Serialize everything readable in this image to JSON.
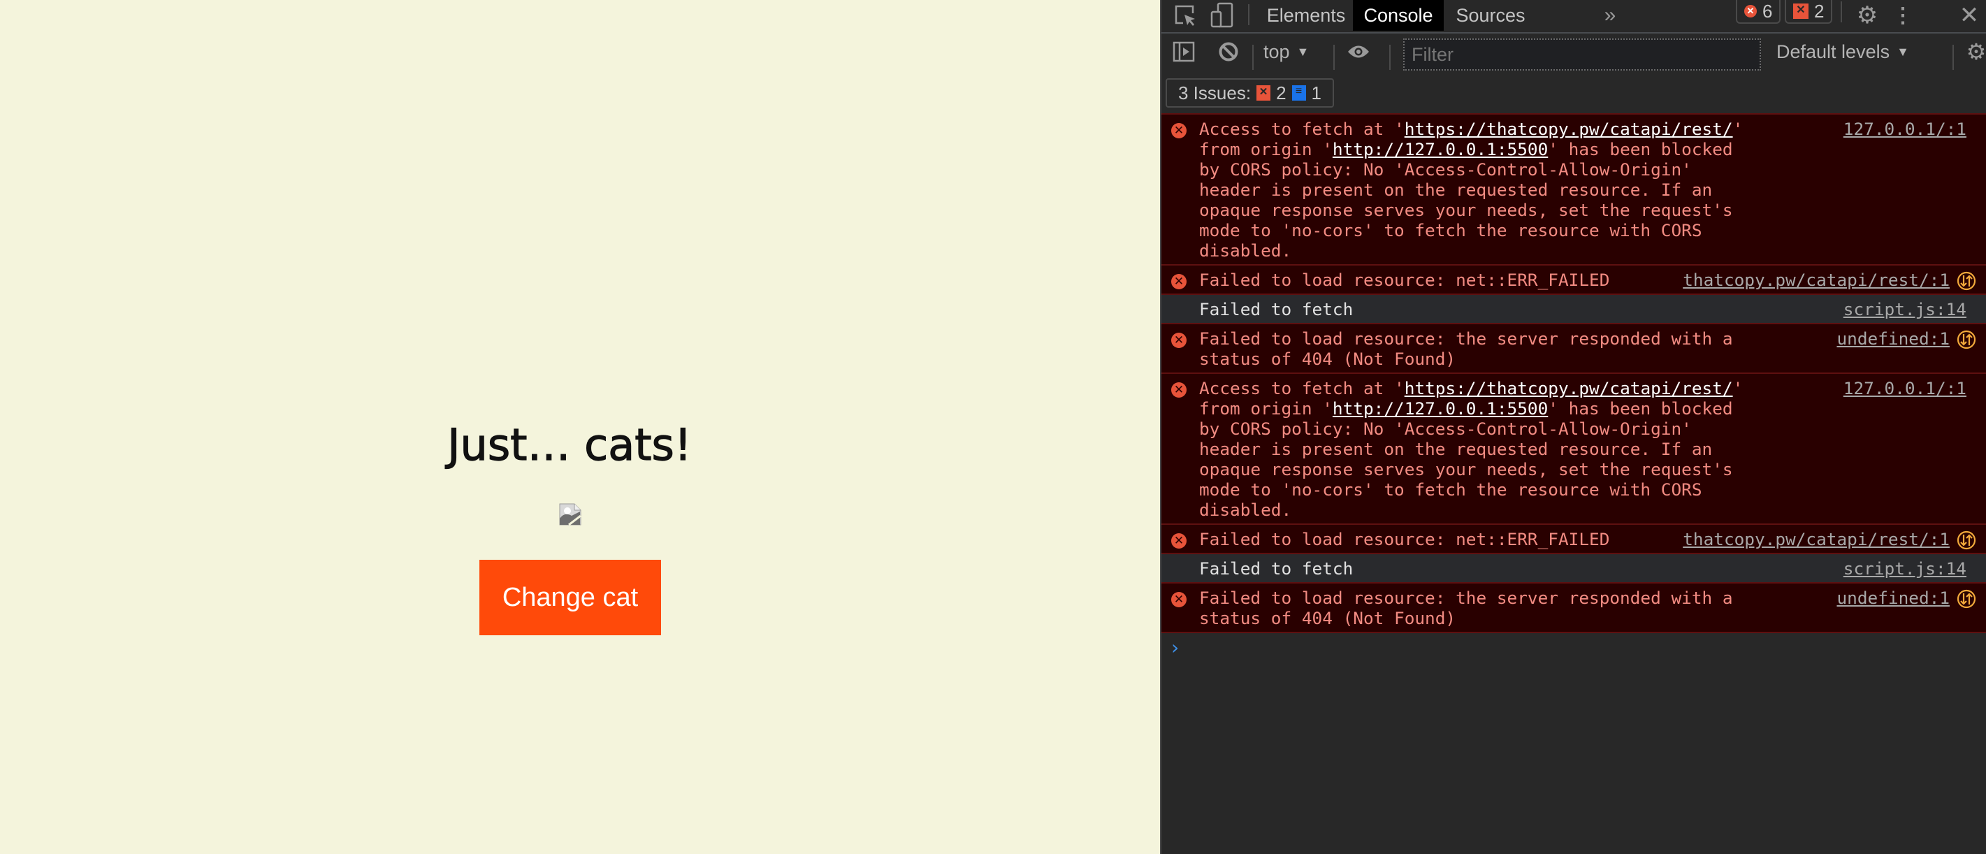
{
  "page": {
    "heading": "Just… cats!",
    "image_state": "broken-image",
    "button_label": "Change cat",
    "colors": {
      "background": "#f4f4dc",
      "button": "#ff4a0a",
      "button_text": "#ffffff"
    }
  },
  "devtools": {
    "tabs": [
      {
        "label": "Elements",
        "active": false
      },
      {
        "label": "Console",
        "active": true
      },
      {
        "label": "Sources",
        "active": false
      }
    ],
    "more_tabs_icon": "chevron-double-right-icon",
    "error_count": "6",
    "issue_count": "2",
    "toolbar": {
      "context": "top",
      "filter_placeholder": "Filter",
      "levels": "Default levels"
    },
    "issues": {
      "label": "3 Issues:",
      "error_issues": "2",
      "info_issues": "1"
    },
    "messages": [
      {
        "type": "error",
        "parts": [
          {
            "t": "Access to fetch at '"
          },
          {
            "t": "https://thatcopy.pw/catapi/rest/",
            "link": true
          },
          {
            "t": "' from origin '"
          },
          {
            "t": "http://127.0.0.1:5500",
            "link": true
          },
          {
            "t": "' has been blocked by CORS policy: No 'Access-Control-Allow-Origin' header is present on the requested resource. If an opaque response serves your needs, set the request's mode to 'no-cors' to fetch the resource with CORS disabled."
          }
        ],
        "source": "127.0.0.1/:1",
        "network_icon": false
      },
      {
        "type": "error",
        "parts": [
          {
            "t": "Failed to load resource: net::ERR_FAILED"
          }
        ],
        "source": "thatcopy.pw/catapi/rest/:1",
        "network_icon": true
      },
      {
        "type": "log",
        "parts": [
          {
            "t": "Failed to fetch"
          }
        ],
        "source": "script.js:14",
        "network_icon": false
      },
      {
        "type": "error",
        "parts": [
          {
            "t": "Failed to load resource: the server responded with a status of 404 (Not Found)"
          }
        ],
        "source": "undefined:1",
        "network_icon": true
      },
      {
        "type": "error",
        "parts": [
          {
            "t": "Access to fetch at '"
          },
          {
            "t": "https://thatcopy.pw/catapi/rest/",
            "link": true
          },
          {
            "t": "' from origin '"
          },
          {
            "t": "http://127.0.0.1:5500",
            "link": true
          },
          {
            "t": "' has been blocked by CORS policy: No 'Access-Control-Allow-Origin' header is present on the requested resource. If an opaque response serves your needs, set the request's mode to 'no-cors' to fetch the resource with CORS disabled."
          }
        ],
        "source": "127.0.0.1/:1",
        "network_icon": false
      },
      {
        "type": "error",
        "parts": [
          {
            "t": "Failed to load resource: net::ERR_FAILED"
          }
        ],
        "source": "thatcopy.pw/catapi/rest/:1",
        "network_icon": true
      },
      {
        "type": "log",
        "parts": [
          {
            "t": "Failed to fetch"
          }
        ],
        "source": "script.js:14",
        "network_icon": false
      },
      {
        "type": "error",
        "parts": [
          {
            "t": "Failed to load resource: the server responded with a status of 404 (Not Found)"
          }
        ],
        "source": "undefined:1",
        "network_icon": true
      }
    ],
    "prompt_symbol": "›",
    "colors": {
      "error_bg": "#290000",
      "error_text": "#f28b82",
      "error_icon": "#e8543a",
      "log_bg": "#292a2d",
      "network_icon": "#f2a93b",
      "prompt": "#3d8ee6"
    }
  }
}
